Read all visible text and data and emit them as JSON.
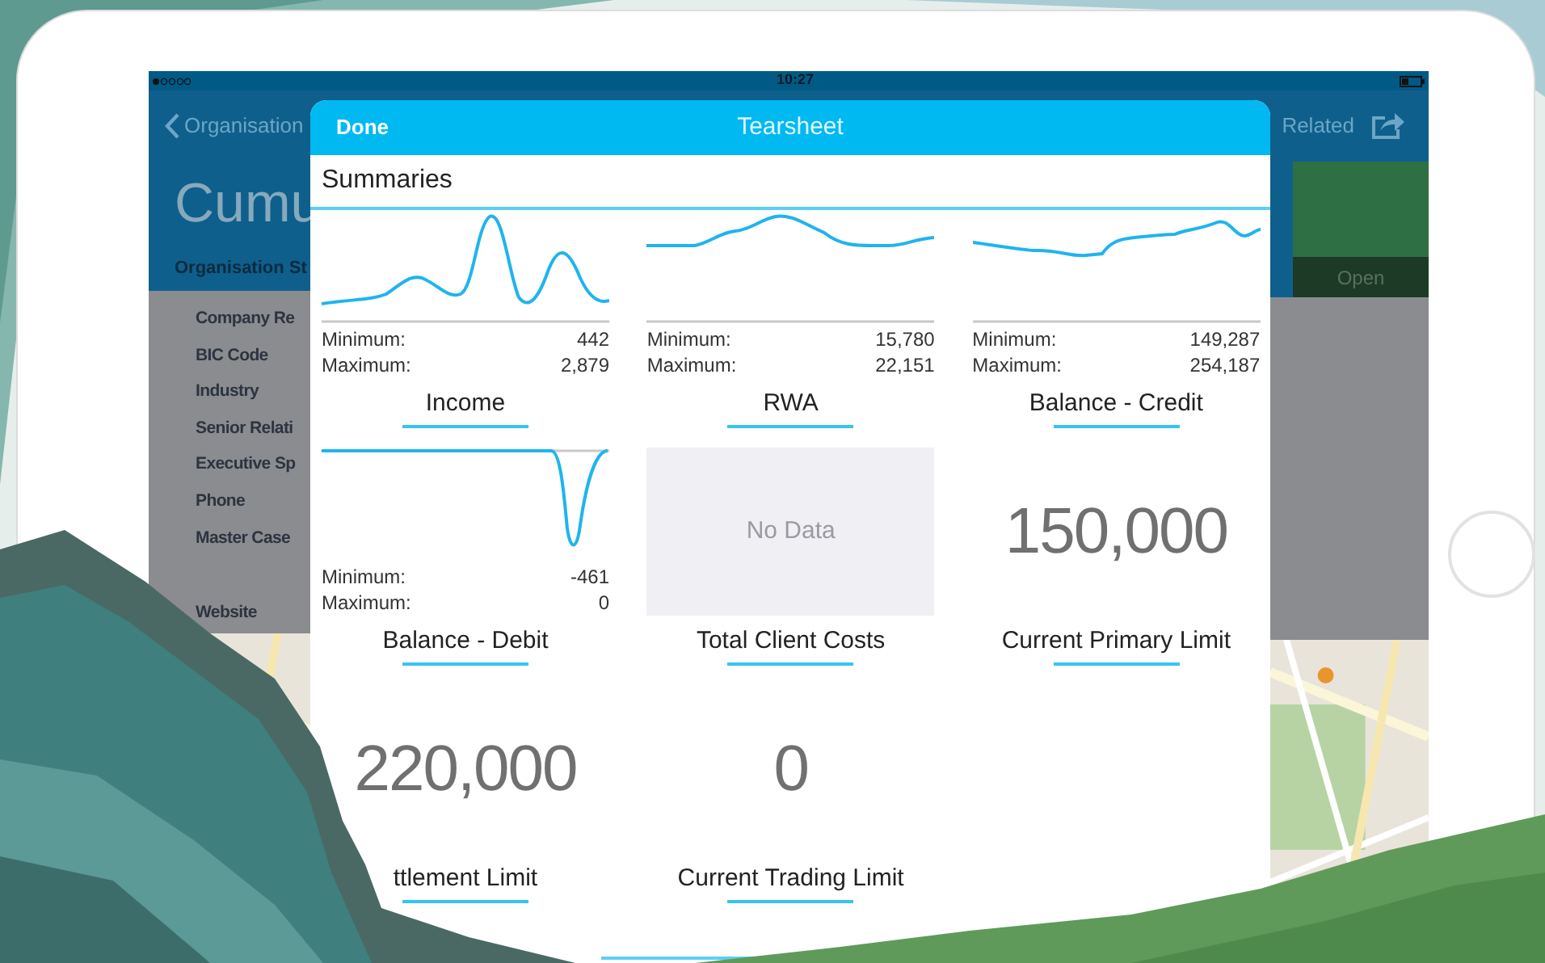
{
  "status_bar": {
    "time": "10:27"
  },
  "background_app": {
    "back_label": "Organisation",
    "title": "Cumu",
    "subtitle": "Organisation St",
    "fields": [
      "Company Re",
      "BIC Code",
      "Industry",
      "Senior Relati",
      "Executive Sp",
      "Phone",
      "Master Case"
    ],
    "footer_field": "Website",
    "related_label": "Related",
    "status_label": "Open"
  },
  "tearsheet": {
    "done": "Done",
    "title": "Tearsheet",
    "section": "Summaries",
    "tiles": [
      {
        "kind": "sparkline",
        "min_label": "Minimum:",
        "min": "442",
        "max_label": "Maximum:",
        "max": "2,879",
        "title": "Income"
      },
      {
        "kind": "sparkline",
        "min_label": "Minimum:",
        "min": "15,780",
        "max_label": "Maximum:",
        "max": "22,151",
        "title": "RWA"
      },
      {
        "kind": "sparkline",
        "min_label": "Minimum:",
        "min": "149,287",
        "max_label": "Maximum:",
        "max": "254,187",
        "title": "Balance - Credit"
      },
      {
        "kind": "sparkline",
        "min_label": "Minimum:",
        "min": "-461",
        "max_label": "Maximum:",
        "max": "0",
        "title": "Balance - Debit"
      },
      {
        "kind": "no_data",
        "message": "No Data",
        "title": "Total Client Costs"
      },
      {
        "kind": "value",
        "value": "150,000",
        "title": "Current Primary Limit"
      },
      {
        "kind": "value",
        "value": "220,000",
        "title": "ttlement Limit"
      },
      {
        "kind": "value",
        "value": "0",
        "title": "Current Trading Limit"
      }
    ]
  }
}
